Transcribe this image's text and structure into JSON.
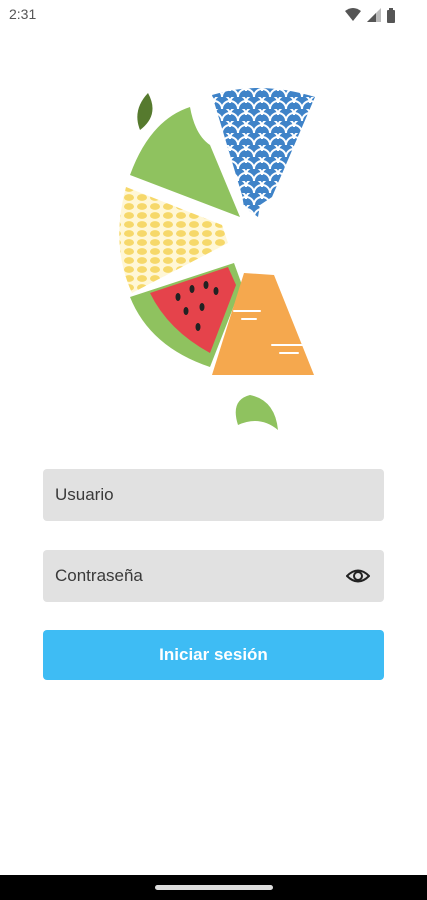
{
  "status_bar": {
    "time": "2:31",
    "icons": [
      "wifi-icon",
      "signal-icon",
      "battery-icon"
    ]
  },
  "login": {
    "user_placeholder": "Usuario",
    "password_placeholder": "Contraseña",
    "submit_label": "Iniciar sesión"
  },
  "colors": {
    "accent": "#3ebcf4",
    "field_bg": "#e1e1e1",
    "logo_green": "#8fc25f",
    "logo_blue": "#3f83c8",
    "logo_yellow": "#f6d86a",
    "logo_red": "#e5434b",
    "logo_orange": "#f5a84e",
    "logo_dark_green": "#567a2e"
  }
}
